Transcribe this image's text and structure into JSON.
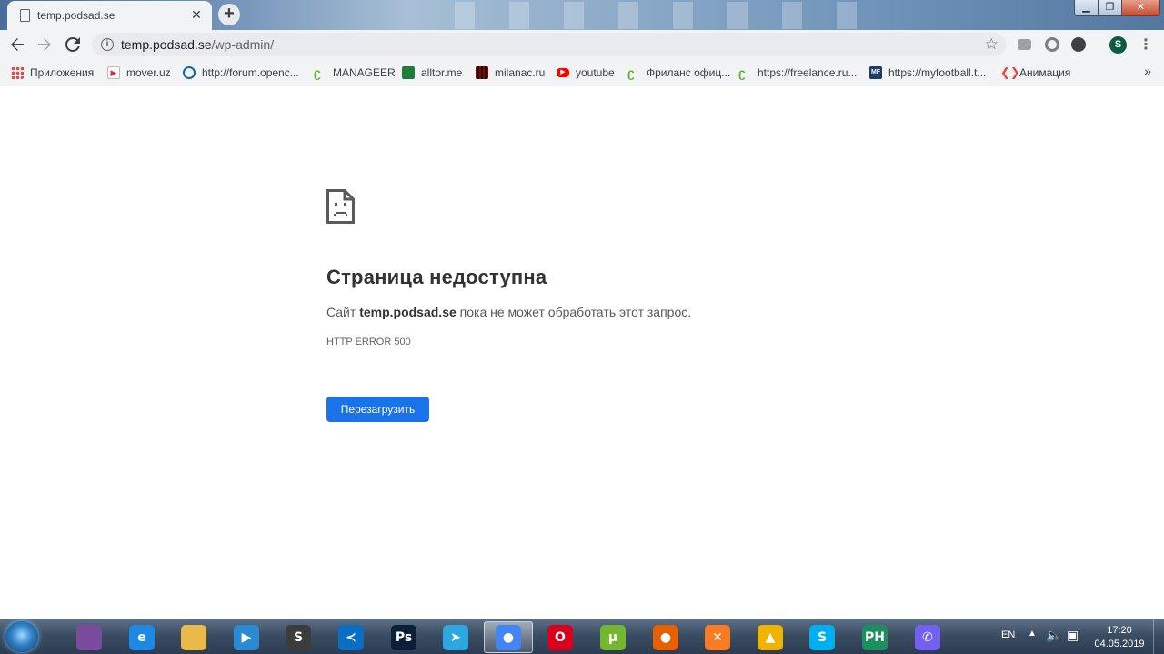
{
  "browser": {
    "tab": {
      "title": "temp.podsad.se"
    },
    "address": {
      "host": "temp.podsad.se",
      "path": "/wp-admin/"
    },
    "profile_initial": "S"
  },
  "bookmarks": [
    {
      "label": "Приложения",
      "icon": "apps-grid-icon",
      "color": "#e8453c"
    },
    {
      "label": "mover.uz",
      "icon": "mover-icon",
      "color": "#d93025"
    },
    {
      "label": "http://forum.openc...",
      "icon": "globe-icon",
      "color": "#1a5fb4"
    },
    {
      "label": "MANAGEER",
      "icon": "freelance-leaf-icon",
      "color": "#5fb72e"
    },
    {
      "label": "alltor.me",
      "icon": "alltor-icon",
      "color": "#1e7d3a"
    },
    {
      "label": "milanac.ru",
      "icon": "milanac-icon",
      "color": "#8b0000"
    },
    {
      "label": "youtube",
      "icon": "youtube-icon",
      "color": "#ff0000"
    },
    {
      "label": "Фриланс офиц...",
      "icon": "freelance-leaf-icon",
      "color": "#5fb72e"
    },
    {
      "label": "https://freelance.ru...",
      "icon": "freelance-leaf-icon",
      "color": "#5fb72e"
    },
    {
      "label": "https://myfootball.t...",
      "icon": "myfootball-icon",
      "color": "#1f3b6b"
    },
    {
      "label": "Анимация",
      "icon": "code-brackets-icon",
      "color": "#e8453c"
    }
  ],
  "error_page": {
    "title": "Страница недоступна",
    "desc_prefix": "Сайт",
    "desc_host": "temp.podsad.se",
    "desc_suffix": "пока не может обработать этот запрос.",
    "code": "HTTP ERROR 500",
    "reload_label": "Перезагрузить",
    "accent": "#1a73e8"
  },
  "taskbar": {
    "apps": [
      {
        "name": "winrar-icon",
        "glyph": "",
        "color": "#7a4b9c"
      },
      {
        "name": "internet-explorer-icon",
        "glyph": "e",
        "color": "#1e88e5"
      },
      {
        "name": "file-explorer-icon",
        "glyph": "",
        "color": "#e9b949"
      },
      {
        "name": "media-player-icon",
        "glyph": "▶",
        "color": "#2a8ad4"
      },
      {
        "name": "sublime-text-icon",
        "glyph": "S",
        "color": "#3c3c3c"
      },
      {
        "name": "visual-studio-code-icon",
        "glyph": "≺",
        "color": "#0a6fc2"
      },
      {
        "name": "photoshop-icon",
        "glyph": "Ps",
        "color": "#0c1f38"
      },
      {
        "name": "telegram-icon",
        "glyph": "➤",
        "color": "#2ea6de"
      },
      {
        "name": "chrome-icon",
        "glyph": "●",
        "color": "#4285f4",
        "active": true
      },
      {
        "name": "opera-icon",
        "glyph": "O",
        "color": "#d8001c"
      },
      {
        "name": "utorrent-icon",
        "glyph": "µ",
        "color": "#74b72e"
      },
      {
        "name": "firefox-icon",
        "glyph": "●",
        "color": "#e66000"
      },
      {
        "name": "xampp-icon",
        "glyph": "✕",
        "color": "#fb7a24"
      },
      {
        "name": "archicad-icon",
        "glyph": "▲",
        "color": "#f2b200"
      },
      {
        "name": "skype-icon",
        "glyph": "S",
        "color": "#00aff0"
      },
      {
        "name": "phpstorm-icon",
        "glyph": "PH",
        "color": "#1c8f5e"
      },
      {
        "name": "viber-icon",
        "glyph": "✆",
        "color": "#7360f2"
      }
    ],
    "lang": "EN",
    "time": "17:20",
    "date": "04.05.2019"
  }
}
